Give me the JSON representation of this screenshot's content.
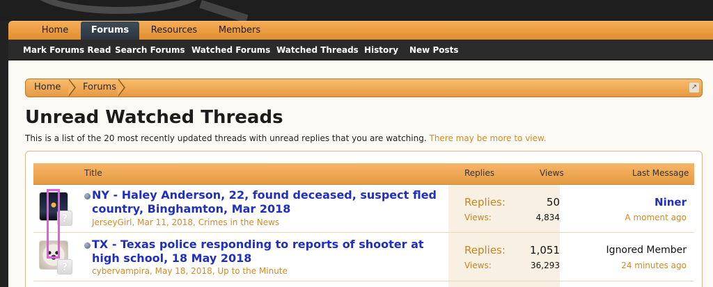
{
  "nav": {
    "tabs": [
      {
        "label": "Home"
      },
      {
        "label": "Forums"
      },
      {
        "label": "Resources"
      },
      {
        "label": "Members"
      }
    ],
    "active": "Forums"
  },
  "subnav": {
    "links": [
      {
        "label": "Mark Forums Read"
      },
      {
        "label": "Search Forums"
      },
      {
        "label": "Watched Forums"
      },
      {
        "label": "Watched Threads"
      },
      {
        "label": "History"
      },
      {
        "label": "New Posts"
      }
    ]
  },
  "breadcrumb": {
    "items": [
      {
        "label": "Home"
      },
      {
        "label": "Forums"
      }
    ]
  },
  "page": {
    "title": "Unread Watched Threads",
    "description": "This is a list of the 20 most recently updated threads with unread replies that you are watching.",
    "more_link": "There may be more to view."
  },
  "list": {
    "headers": {
      "title": "Title",
      "replies": "Replies",
      "views": "Views",
      "last_message": "Last Message"
    },
    "threads": [
      {
        "title": "NY - Haley Anderson, 22, found deceased, suspect fled country, Binghamton, Mar 2018",
        "author": "JerseyGirl",
        "date": "Mar 11, 2018",
        "forum": "Crimes in the News",
        "replies_label": "Replies:",
        "replies": "50",
        "views_label": "Views:",
        "views": "4,834",
        "last_poster": "Niner",
        "last_time": "A moment ago",
        "avatar": "night-scene-avatar"
      },
      {
        "title": "TX - Texas police responding to reports of shooter at high school, 18 May 2018",
        "author": "cybervampira",
        "date": "May 18, 2018",
        "forum": "Up to the Minute",
        "replies_label": "Replies:",
        "replies": "1,051",
        "views_label": "Views:",
        "views": "36,293",
        "last_poster": "Ignored Member",
        "last_time": "24 minutes ago",
        "avatar": "dog-avatar"
      }
    ]
  },
  "icons": {
    "mini_avatar": "?",
    "jump": "↗"
  },
  "colors": {
    "accent": "#e69a44",
    "link": "#1f2fc0",
    "meta": "#d18a26",
    "highlight": "#e65be3"
  }
}
